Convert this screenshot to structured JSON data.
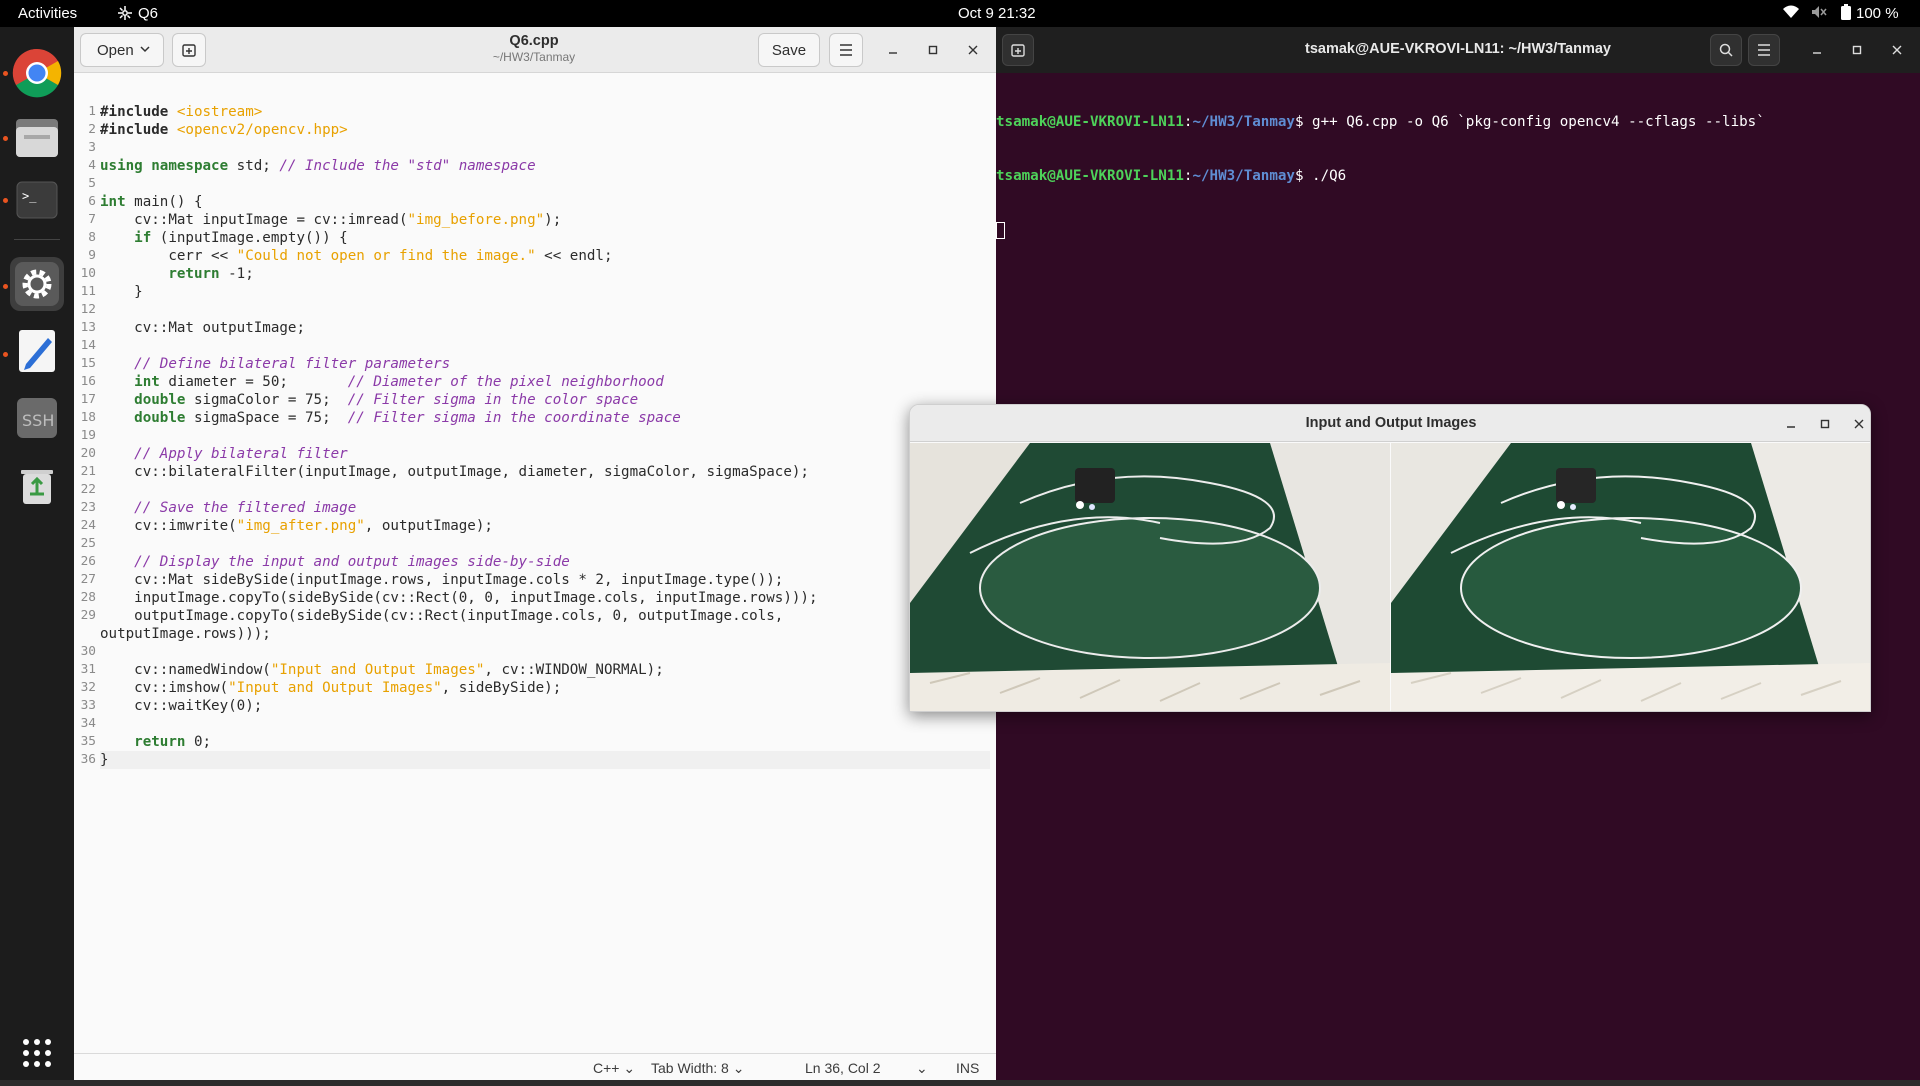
{
  "topbar": {
    "activities": "Activities",
    "app_name": "Q6",
    "clock": "Oct 9  21:32",
    "battery": "100 %"
  },
  "dock": {
    "items": [
      "chrome-icon",
      "files-icon",
      "terminal-icon",
      "settings-icon",
      "text-editor-icon",
      "ssh-icon",
      "trash-icon"
    ],
    "show_apps": "apps-grid-icon"
  },
  "editor": {
    "open_label": "Open",
    "title": "Q6.cpp",
    "subtitle": "~/HW3/Tanmay",
    "save_label": "Save",
    "lines": [
      [
        {
          "t": "#include ",
          "c": "pp"
        },
        {
          "t": "<iostream>",
          "c": "st"
        }
      ],
      [
        {
          "t": "#include ",
          "c": "pp"
        },
        {
          "t": "<opencv2/opencv.hpp>",
          "c": "st"
        }
      ],
      [],
      [
        {
          "t": "using namespace",
          "c": "kw"
        },
        {
          "t": " std; ",
          "c": "nm"
        },
        {
          "t": "// Include the \"std\" namespace",
          "c": "cm"
        }
      ],
      [],
      [
        {
          "t": "int",
          "c": "ty"
        },
        {
          "t": " main() {",
          "c": "nm"
        }
      ],
      [
        {
          "t": "    cv::Mat inputImage = cv::imread(",
          "c": "nm"
        },
        {
          "t": "\"img_before.png\"",
          "c": "st"
        },
        {
          "t": ");",
          "c": "nm"
        }
      ],
      [
        {
          "t": "    ",
          "c": "nm"
        },
        {
          "t": "if",
          "c": "kw"
        },
        {
          "t": " (inputImage.empty()) {",
          "c": "nm"
        }
      ],
      [
        {
          "t": "        cerr << ",
          "c": "nm"
        },
        {
          "t": "\"Could not open or find the image.\"",
          "c": "st"
        },
        {
          "t": " << endl;",
          "c": "nm"
        }
      ],
      [
        {
          "t": "        ",
          "c": "nm"
        },
        {
          "t": "return",
          "c": "kw"
        },
        {
          "t": " -1;",
          "c": "nm"
        }
      ],
      [
        {
          "t": "    }",
          "c": "nm"
        }
      ],
      [],
      [
        {
          "t": "    cv::Mat outputImage;",
          "c": "nm"
        }
      ],
      [],
      [
        {
          "t": "    ",
          "c": "nm"
        },
        {
          "t": "// Define bilateral filter parameters",
          "c": "cm"
        }
      ],
      [
        {
          "t": "    ",
          "c": "nm"
        },
        {
          "t": "int",
          "c": "ty"
        },
        {
          "t": " diameter = 50;       ",
          "c": "nm"
        },
        {
          "t": "// Diameter of the pixel neighborhood",
          "c": "cm"
        }
      ],
      [
        {
          "t": "    ",
          "c": "nm"
        },
        {
          "t": "double",
          "c": "ty"
        },
        {
          "t": " sigmaColor = 75;  ",
          "c": "nm"
        },
        {
          "t": "// Filter sigma in the color space",
          "c": "cm"
        }
      ],
      [
        {
          "t": "    ",
          "c": "nm"
        },
        {
          "t": "double",
          "c": "ty"
        },
        {
          "t": " sigmaSpace = 75;  ",
          "c": "nm"
        },
        {
          "t": "// Filter sigma in the coordinate space",
          "c": "cm"
        }
      ],
      [],
      [
        {
          "t": "    ",
          "c": "nm"
        },
        {
          "t": "// Apply bilateral filter",
          "c": "cm"
        }
      ],
      [
        {
          "t": "    cv::bilateralFilter(inputImage, outputImage, diameter, sigmaColor, sigmaSpace);",
          "c": "nm"
        }
      ],
      [],
      [
        {
          "t": "    ",
          "c": "nm"
        },
        {
          "t": "// Save the filtered image",
          "c": "cm"
        }
      ],
      [
        {
          "t": "    cv::imwrite(",
          "c": "nm"
        },
        {
          "t": "\"img_after.png\"",
          "c": "st"
        },
        {
          "t": ", outputImage);",
          "c": "nm"
        }
      ],
      [],
      [
        {
          "t": "    ",
          "c": "nm"
        },
        {
          "t": "// Display the input and output images side-by-side",
          "c": "cm"
        }
      ],
      [
        {
          "t": "    cv::Mat sideBySide(inputImage.rows, inputImage.cols * 2, inputImage.type());",
          "c": "nm"
        }
      ],
      [
        {
          "t": "    inputImage.copyTo(sideBySide(cv::Rect(0, 0, inputImage.cols, inputImage.rows)));",
          "c": "nm"
        }
      ],
      [
        {
          "t": "    outputImage.copyTo(sideBySide(cv::Rect(inputImage.cols, 0, outputImage.cols,",
          "c": "nm"
        }
      ],
      [
        {
          "t": "outputImage.rows)));",
          "c": "nm"
        }
      ],
      [],
      [
        {
          "t": "    cv::namedWindow(",
          "c": "nm"
        },
        {
          "t": "\"Input and Output Images\"",
          "c": "st"
        },
        {
          "t": ", cv::WINDOW_NORMAL);",
          "c": "nm"
        }
      ],
      [
        {
          "t": "    cv::imshow(",
          "c": "nm"
        },
        {
          "t": "\"Input and Output Images\"",
          "c": "st"
        },
        {
          "t": ", sideBySide);",
          "c": "nm"
        }
      ],
      [
        {
          "t": "    cv::waitKey(0);",
          "c": "nm"
        }
      ],
      [],
      [
        {
          "t": "    ",
          "c": "nm"
        },
        {
          "t": "return",
          "c": "kw"
        },
        {
          "t": " 0;",
          "c": "nm"
        }
      ],
      [
        {
          "t": "}",
          "c": "nm"
        }
      ]
    ],
    "line_numbers": [
      "1",
      "2",
      "3",
      "4",
      "5",
      "6",
      "7",
      "8",
      "9",
      "10",
      "11",
      "12",
      "13",
      "14",
      "15",
      "16",
      "17",
      "18",
      "19",
      "20",
      "21",
      "22",
      "23",
      "24",
      "25",
      "26",
      "27",
      "28",
      "29",
      "",
      "30",
      "31",
      "32",
      "33",
      "34",
      "35",
      "36"
    ],
    "current_line": 36,
    "status": {
      "language": "C++",
      "tab_width": "Tab Width: 8",
      "position": "Ln 36, Col 2",
      "mode": "INS"
    }
  },
  "terminal": {
    "title": "tsamak@AUE-VKROVI-LN11: ~/HW3/Tanmay",
    "lines": [
      {
        "user": "tsamak@AUE-VKROVI-LN11",
        "sep": ":",
        "path": "~/HW3/Tanmay",
        "cmd": "$ g++ Q6.cpp -o Q6 `pkg-config opencv4 --cflags --libs`"
      },
      {
        "user": "tsamak@AUE-VKROVI-LN11",
        "sep": ":",
        "path": "~/HW3/Tanmay",
        "cmd": "$ ./Q6"
      }
    ]
  },
  "image_window": {
    "title": "Input and Output Images"
  },
  "colors": {
    "terminal_bg": "#300a24",
    "accent": "#e95420",
    "prompt_user": "#4ed25a",
    "prompt_path": "#5f8dd3"
  }
}
